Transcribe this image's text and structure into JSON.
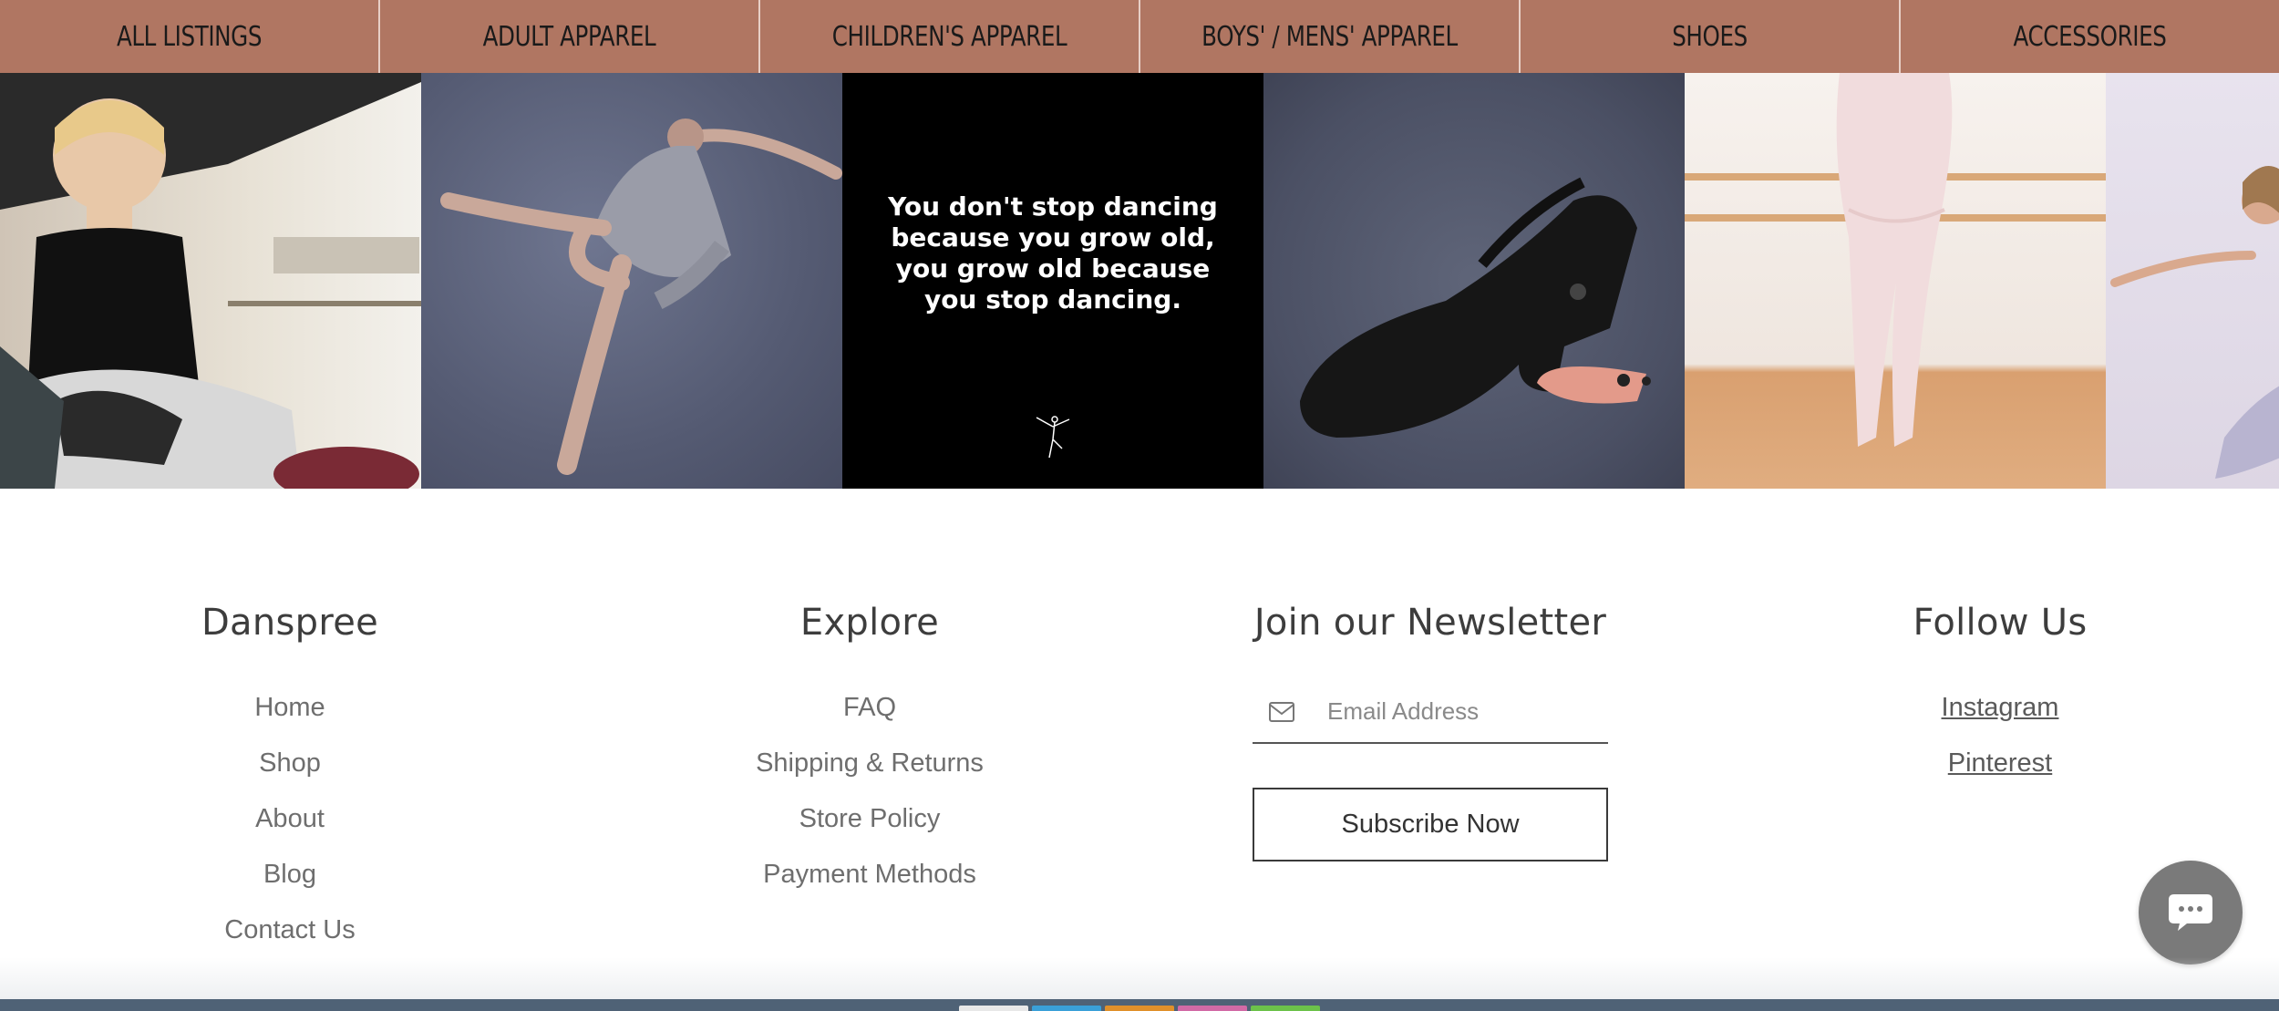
{
  "nav": {
    "items": [
      {
        "label": "ALL LISTINGS"
      },
      {
        "label": "ADULT APPAREL"
      },
      {
        "label": "CHILDREN'S APPAREL"
      },
      {
        "label": "BOYS' / MENS' APPAREL"
      },
      {
        "label": "SHOES"
      },
      {
        "label": "ACCESSORIES"
      }
    ]
  },
  "gallery": {
    "quote": "You don't stop dancing because you grow old, you grow old because you stop dancing."
  },
  "footer": {
    "brand": {
      "heading": "Danspree",
      "links": [
        "Home",
        "Shop",
        "About",
        "Blog",
        "Contact Us"
      ]
    },
    "explore": {
      "heading": "Explore",
      "links": [
        "FAQ",
        "Shipping & Returns",
        "Store Policy",
        "Payment Methods"
      ]
    },
    "newsletter": {
      "heading": "Join our Newsletter",
      "email_placeholder": "Email Address",
      "subscribe_label": "Subscribe Now"
    },
    "follow": {
      "heading": "Follow Us",
      "links": [
        "Instagram",
        "Pinterest"
      ]
    }
  },
  "colors": {
    "nav_background": "#b07662",
    "text_dark": "#3d3d3d",
    "text_muted": "#6e6e6e",
    "chat_bubble": "#7a7a7a"
  },
  "icons": [
    "mail-icon",
    "chat-icon",
    "dancer-logo-icon"
  ]
}
